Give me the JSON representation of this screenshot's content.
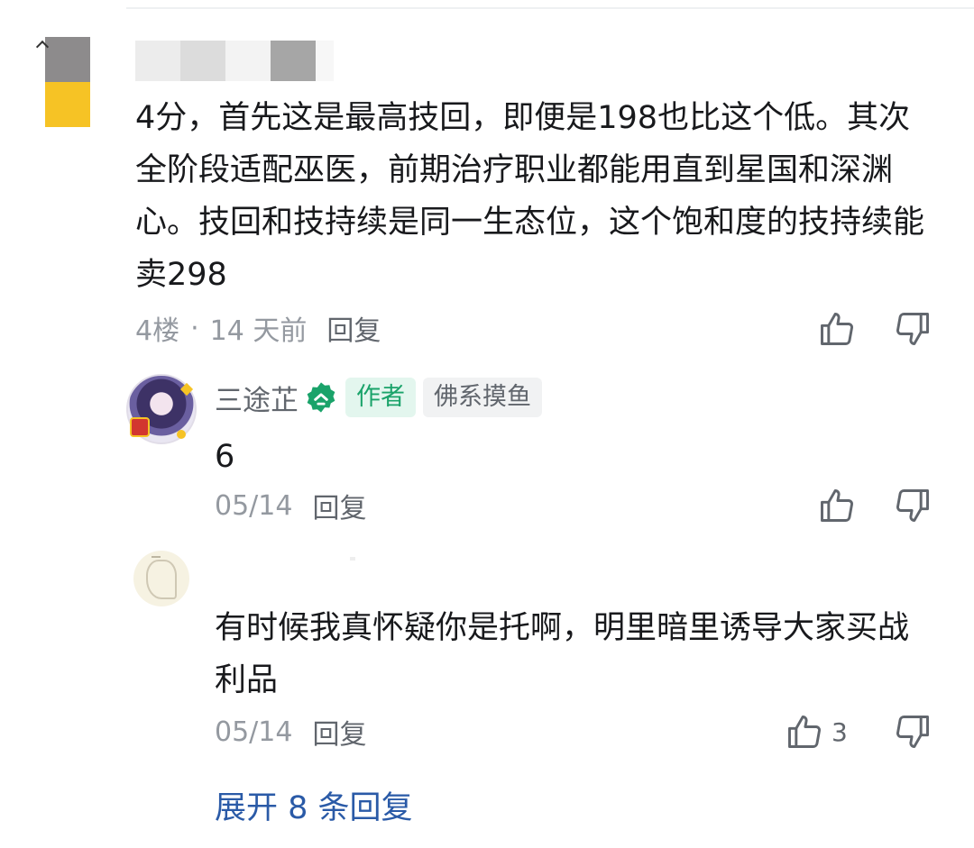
{
  "main_comment": {
    "text": "4分，首先这是最高技回，即便是198也比这个低。其次全阶段适配巫医，前期治疗职业都能用直到星国和深渊心。技回和技持续是同一生态位，这个饱和度的技持续能卖298",
    "floor": "4楼",
    "time": "14 天前",
    "reply_label": "回复"
  },
  "replies": [
    {
      "username": "三途芷",
      "tags": [
        "作者",
        "佛系摸鱼"
      ],
      "text": "6",
      "date": "05/14",
      "reply_label": "回复"
    },
    {
      "text": "有时候我真怀疑你是托啊，明里暗里诱导大家买战利品",
      "date": "05/14",
      "reply_label": "回复",
      "like_count": "3"
    }
  ],
  "expand_label": "展开 8 条回复",
  "icons": {
    "like": "thumbs-up-icon",
    "dislike": "thumbs-down-icon",
    "level": "green-level-badge-icon"
  },
  "colors": {
    "link": "#2a5aa7",
    "author_tag": "#1aa36a",
    "meta_gray": "#9499a0"
  }
}
